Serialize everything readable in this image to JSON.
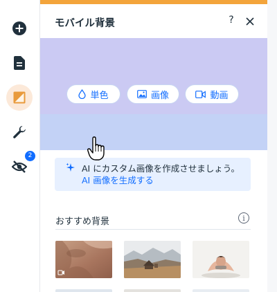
{
  "rail": {
    "items": [
      {
        "name": "add",
        "icon": "plus-circle-icon"
      },
      {
        "name": "pages",
        "icon": "page-icon"
      },
      {
        "name": "background",
        "icon": "background-icon",
        "active": true
      },
      {
        "name": "settings",
        "icon": "wrench-icon"
      },
      {
        "name": "hidden-elements",
        "icon": "eye-off-icon",
        "badge": "2"
      }
    ],
    "accent_active_bg": "#fce9d9",
    "badge_color": "#116dff"
  },
  "panel": {
    "title": "モバイル背景",
    "help_label": "?",
    "close_icon": "close-icon",
    "accent_bar_color": "#f3a43b",
    "preview": {
      "color_top": "#cbcaf3",
      "color_bottom": "#c3d2f6",
      "buttons": {
        "color": "単色",
        "image": "画像",
        "video": "動画"
      }
    },
    "ai_banner": {
      "text": "AI にカスタム画像を作成させましょう。",
      "link": "AI 画像を生成する"
    },
    "recommended": {
      "title": "おすすめ背景",
      "info_label": "i",
      "thumbnails": [
        {
          "name": "leaf-shadow",
          "has_video_icon": true
        },
        {
          "name": "mountain-cabin"
        },
        {
          "name": "yoga-pose"
        }
      ]
    }
  },
  "link_color": "#116dff"
}
